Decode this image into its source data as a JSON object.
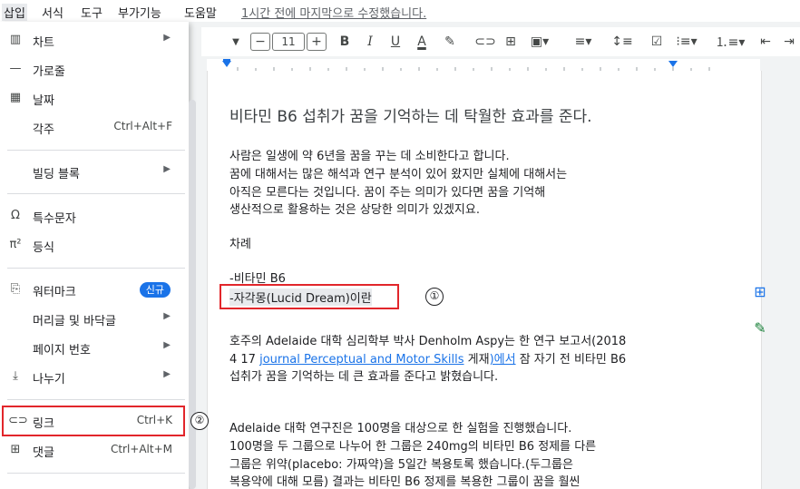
{
  "menubar": {
    "items": [
      "삽입",
      "서식",
      "도구",
      "부가기능",
      "도움말"
    ],
    "last_modified": "1시간 전에 마지막으로 수정했습니다."
  },
  "toolbar": {
    "font_size": "11",
    "minus": "−",
    "plus": "+",
    "bold": "B",
    "italic": "I",
    "underline": "U",
    "text_color": "A"
  },
  "insert_menu": {
    "items": [
      {
        "label": "차트",
        "icon": "chart-icon"
      },
      {
        "label": "가로줄",
        "icon": "horizontal-line-icon"
      },
      {
        "label": "날짜",
        "icon": "calendar-icon"
      },
      {
        "label": "각주",
        "shortcut": "Ctrl+Alt+F"
      },
      {
        "label": "빌딩 블록"
      },
      {
        "label": "특수문자",
        "icon": "omega-icon"
      },
      {
        "label": "등식",
        "icon": "equation-icon"
      },
      {
        "label": "워터마크",
        "icon": "watermark-icon",
        "badge": "신규"
      },
      {
        "label": "머리글 및 바닥글"
      },
      {
        "label": "페이지 번호"
      },
      {
        "label": "나누기",
        "icon": "page-break-icon"
      },
      {
        "label": "링크",
        "icon": "link-icon",
        "shortcut": "Ctrl+K"
      },
      {
        "label": "댓글",
        "icon": "comment-icon",
        "shortcut": "Ctrl+Alt+M"
      }
    ]
  },
  "document": {
    "title": "비타민 B6 섭취가 꿈을 기억하는 데 탁월한 효과를 준다.",
    "para1": [
      "사람은 일생에 약 6년을 꿈을 꾸는 데 소비한다고 합니다.",
      "꿈에 대해서는 많은 해석과 연구 분석이 있어 왔지만 실체에 대해서는",
      "아직은 모른다는 것입니다. 꿈이 주는 의미가 있다면 꿈을 기억해",
      "생산적으로 활용하는 것은 상당한 의미가 있겠지요."
    ],
    "toc_heading": "차례",
    "toc": [
      "-비타민 B6",
      "-자각몽(Lucid Dream)이란"
    ],
    "para2_line1": "호주의 Adelaide 대학 심리학부 박사 Denholm Aspy는 한 연구 보고서(2018",
    "para2_line2_pre": "4 17 ",
    "para2_line2_link": "journal Perceptual and Motor Skills",
    "para2_line2_mid": " 게재",
    "para2_line2_link2": ")에서",
    "para2_line2_post": " 잠 자기 전 비타민 B6",
    "para2_line3": "섭취가 꿈을 기억하는 데 큰 효과를 준다고 밝혔습니다.",
    "para3": [
      "Adelaide 대학 연구진은 100명을 대상으로 한 실험을 진행했습니다.",
      "100명을 두 그룹으로 나누어 한 그룹은 240mg의 비타민 B6 정제를 다른",
      "그룹은 위약(placebo: 가짜약)을 5일간 복용토록 했습니다.(두그룹은",
      "복용약에 대해 모름) 결과는 비타민 B6 정제를 복용한 그룹이 꿈을 훨씬"
    ]
  },
  "annotations": {
    "marker1": "①",
    "marker2": "②"
  },
  "colors": {
    "highlight_red": "#e2262b",
    "accent_blue": "#1a73e8",
    "link_blue": "#1a73e8"
  }
}
